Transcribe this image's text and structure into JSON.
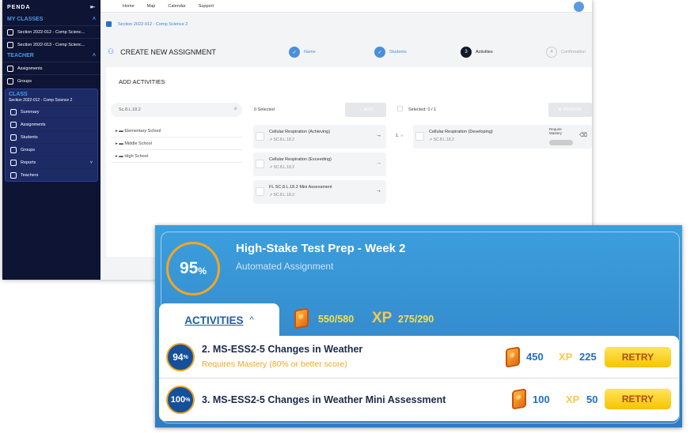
{
  "back": {
    "sidebar": {
      "brand": "PENDA",
      "my_classes": "MY CLASSES",
      "classes": [
        "Section 2022-012 - Comp Scienc...",
        "Section 2022-013 - Comp Scienc..."
      ],
      "teacher": "TEACHER",
      "teacher_items": [
        "Assignments",
        "Groups"
      ],
      "class_label": "CLASS",
      "class_name": "Section 2022-012 - Comp Science 2",
      "class_items": [
        "Summary",
        "Assignments",
        "Students",
        "Groups",
        "Reports",
        "Teachers"
      ]
    },
    "nav": [
      "Home",
      "Map",
      "Calendar",
      "Support"
    ],
    "breadcrumb": "Section 2022-012 - Comp Science 2",
    "title": "CREATE NEW ASSIGNMENT",
    "steps": [
      {
        "n": "✓",
        "label": "Name"
      },
      {
        "n": "✓",
        "label": "Students"
      },
      {
        "n": "3",
        "label": "Activities"
      },
      {
        "n": "4",
        "label": "Confirmation"
      }
    ],
    "section": "ADD ACTIVITIES",
    "search_value": "Sc.8.L.18.2",
    "tree": [
      "Elementary School",
      "Middle School",
      "High School"
    ],
    "selected_left": "0 Selected",
    "add": "ADD",
    "selected_right": "Selected:  0 / 1",
    "remove": "REMOVE",
    "available": [
      {
        "name": "Cellular Respiration (Achieving)",
        "code": "SC.8.L.18.2"
      },
      {
        "name": "Cellular Respiration (Exceeding)",
        "code": "SC.8.L.18.2"
      },
      {
        "name": "FL SC.8.L.18.2 Mini Assessment",
        "code": "SC.8.L.18.2"
      }
    ],
    "chosen": {
      "index": "1.",
      "name": "Cellular Respiration (Developing)",
      "code": "SC.8.L.18.2",
      "mastery": "Require Mastery"
    }
  },
  "front": {
    "score": "95",
    "pct": "%",
    "title": "High-Stake Test Prep - Week 2",
    "subtitle": "Automated Assignment",
    "tab": "ACTIVITIES",
    "coins": "550/580",
    "xp_label": "XP",
    "xp": "275/290",
    "rows": [
      {
        "score": "94",
        "title": "2. MS-ESS2-5 Changes in Weather",
        "note": "Requires Mastery (80% or better score)",
        "coins": "450",
        "xp": "225",
        "button": "RETRY"
      },
      {
        "score": "100",
        "title": "3. MS-ESS2-5 Changes in Weather Mini Assessment",
        "note": "",
        "coins": "100",
        "xp": "50",
        "button": "RETRY"
      }
    ]
  },
  "colors": {
    "sidebar": "#0e1433",
    "accent": "#3b82d6",
    "card": "#3c9fdd",
    "orange": "#f5a623",
    "retry": "#f6c400"
  }
}
